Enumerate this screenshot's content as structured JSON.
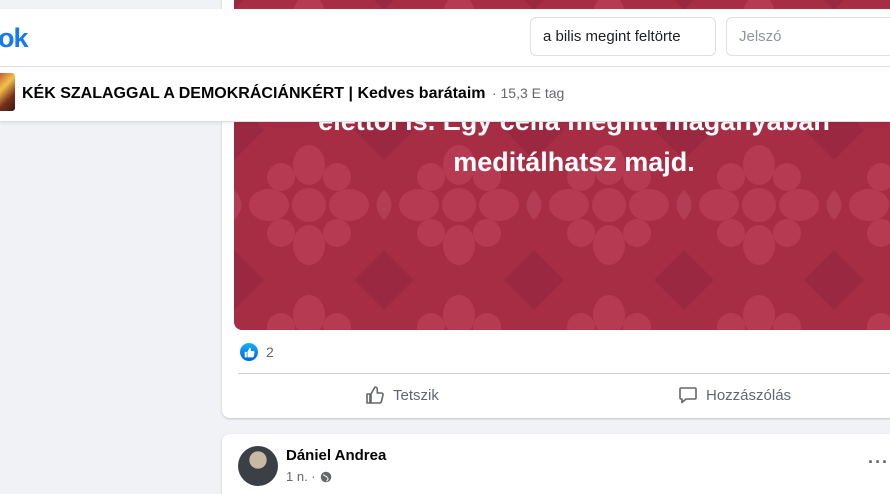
{
  "nav": {
    "logo_text": "ok",
    "search_value": "a bilis megint feltörte",
    "password_placeholder": "Jelszó"
  },
  "group": {
    "name": "KÉK SZALAGGAL A DEMOKRÁCIÁNKÉRT | Kedves barátaim",
    "members": "· 15,3 E tag"
  },
  "post": {
    "image_text_line1": "élettől is. Egy cella megfitt magányában",
    "image_text_line2": "meditálhatsz majd.",
    "reaction_count": "2",
    "like_label": "Tetszik",
    "comment_label": "Hozzászólás"
  },
  "post2": {
    "author": "Dániel Andrea",
    "time": "1 n. ·"
  },
  "colors": {
    "brand": "#1877f2",
    "image_bg": "#a72d45"
  },
  "icons": {
    "like": "thumbs-up-icon",
    "comment": "comment-icon",
    "privacy": "globe-icon",
    "more": "more-dots-icon"
  }
}
